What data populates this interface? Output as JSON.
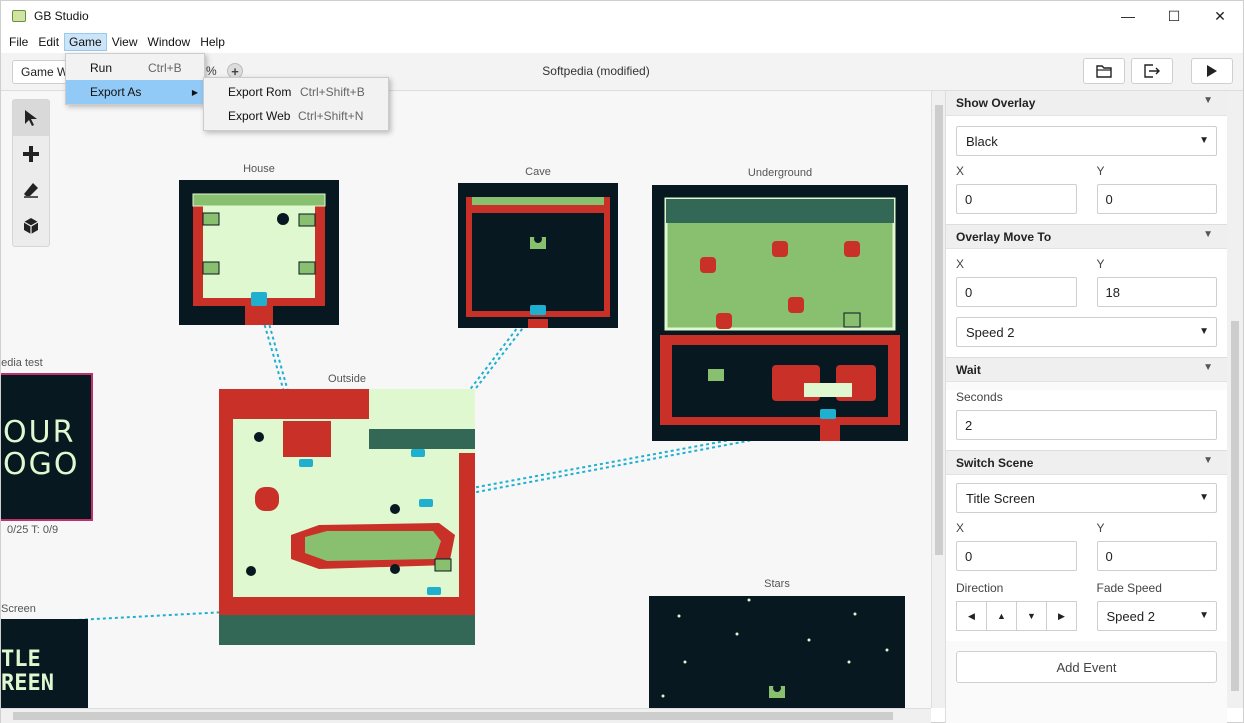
{
  "app": {
    "title": "GB Studio"
  },
  "window_controls": {
    "minimize": "—",
    "maximize": "☐",
    "close": "✕"
  },
  "menubar": [
    {
      "label": "File"
    },
    {
      "label": "Edit"
    },
    {
      "label": "Game"
    },
    {
      "label": "View"
    },
    {
      "label": "Window"
    },
    {
      "label": "Help"
    }
  ],
  "toolbar": {
    "world_select": "Game W",
    "zoom_suffix": "%",
    "zoom_plus": "+",
    "project_title": "Softpedia (modified)"
  },
  "game_menu": {
    "run": {
      "label": "Run",
      "shortcut": "Ctrl+B"
    },
    "export_as": {
      "label": "Export As"
    }
  },
  "export_menu": {
    "rom": {
      "label": "Export Rom",
      "shortcut": "Ctrl+Shift+B"
    },
    "web": {
      "label": "Export Web",
      "shortcut": "Ctrl+Shift+N"
    }
  },
  "scenes": {
    "house": "House",
    "cave": "Cave",
    "underground": "Underground",
    "outside": "Outside",
    "stars": "Stars",
    "softpedia_test": "pedia test",
    "softpedia_test_logo_1": "OUR",
    "softpedia_test_logo_2": "OGO",
    "softpedia_test_stats": "0/25   T: 0/9",
    "title_screen": "Screen",
    "title_screen_1": "TLE",
    "title_screen_2": "REEN"
  },
  "sidebar": {
    "show_overlay": {
      "title": "Show Overlay",
      "color": "Black",
      "x_label": "X",
      "x": "0",
      "y_label": "Y",
      "y": "0"
    },
    "overlay_move_to": {
      "title": "Overlay Move To",
      "x_label": "X",
      "x": "0",
      "y_label": "Y",
      "y": "18",
      "speed": "Speed 2"
    },
    "wait": {
      "title": "Wait",
      "seconds_label": "Seconds",
      "seconds": "2"
    },
    "switch_scene": {
      "title": "Switch Scene",
      "scene": "Title Screen",
      "x_label": "X",
      "x": "0",
      "y_label": "Y",
      "y": "0",
      "direction_label": "Direction",
      "fade_label": "Fade Speed",
      "fade": "Speed 2"
    },
    "add_event": "Add Event"
  },
  "colors": {
    "dark": "#081820",
    "light_green": "#e0f8d0",
    "mid_green": "#88c070",
    "red": "#c83028",
    "connector": "#1fb0d0"
  }
}
